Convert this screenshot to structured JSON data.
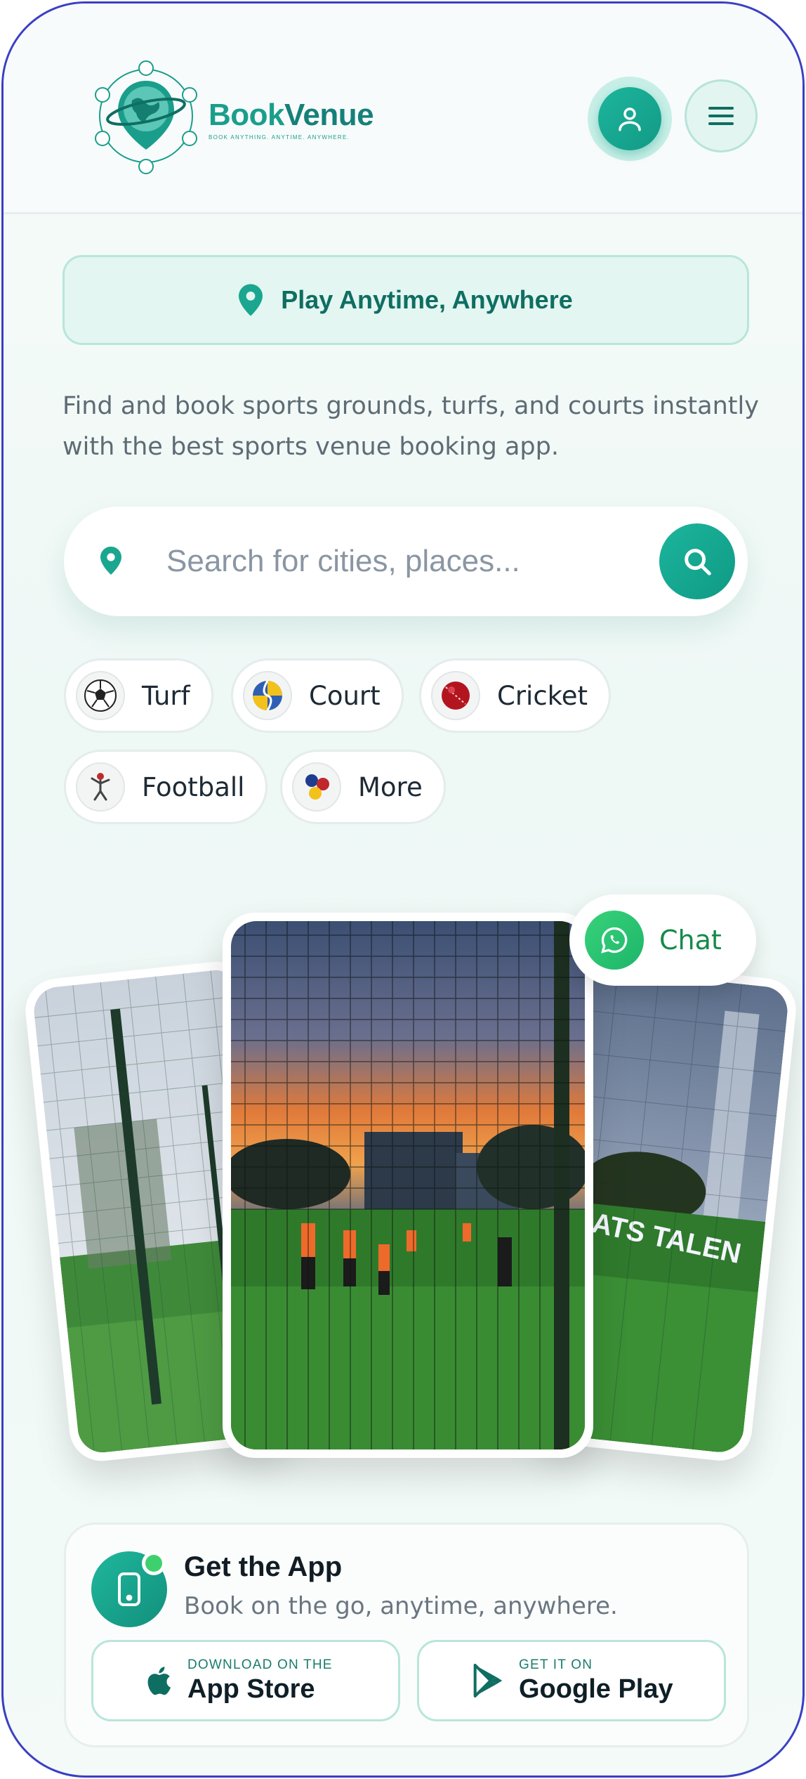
{
  "brand": {
    "name_part1": "Book",
    "name_part2": "Venue",
    "tagline": "BOOK ANYTHING. ANYTIME. ANYWHERE."
  },
  "hero": {
    "pill_text": "Play Anytime, Anywhere",
    "description": "Find and book sports grounds, turfs, and courts instantly with the best sports venue booking app."
  },
  "search": {
    "placeholder": "Search for cities, places..."
  },
  "categories": [
    {
      "label": "Turf",
      "icon": "soccer-ball-icon"
    },
    {
      "label": "Court",
      "icon": "volleyball-icon"
    },
    {
      "label": "Cricket",
      "icon": "cricket-ball-icon"
    },
    {
      "label": "Football",
      "icon": "football-player-icon"
    },
    {
      "label": "More",
      "icon": "more-balls-icon"
    }
  ],
  "chat": {
    "label": "Chat"
  },
  "app_promo": {
    "title": "Get the App",
    "subtitle": "Book on the go, anytime, anywhere.",
    "appstore_small": "DOWNLOAD ON THE",
    "appstore_big": "App Store",
    "google_small": "GET IT ON",
    "google_big": "Google Play"
  },
  "colors": {
    "accent": "#1aa68f",
    "accent_dark": "#0f6e62",
    "frame": "#3a3fc4"
  }
}
